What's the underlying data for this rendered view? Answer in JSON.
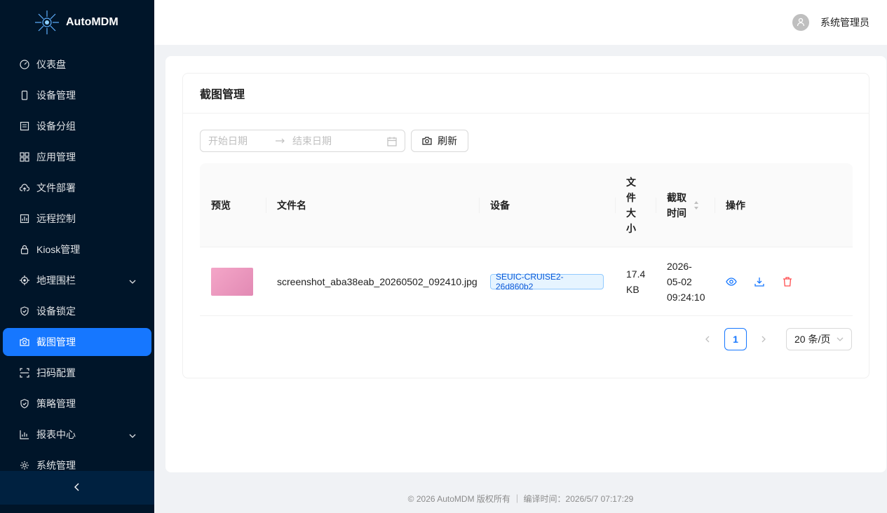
{
  "app": {
    "name": "AutoMDM"
  },
  "sidebar": {
    "items": [
      {
        "label": "仪表盘",
        "icon": "dashboard-icon"
      },
      {
        "label": "设备管理",
        "icon": "mobile-icon"
      },
      {
        "label": "设备分组",
        "icon": "group-icon"
      },
      {
        "label": "应用管理",
        "icon": "appstore-icon"
      },
      {
        "label": "文件部署",
        "icon": "cloud-upload-icon"
      },
      {
        "label": "远程控制",
        "icon": "remote-control-icon"
      },
      {
        "label": "Kiosk管理",
        "icon": "lock-icon"
      },
      {
        "label": "地理围栏",
        "icon": "aim-icon",
        "has_submenu": true
      },
      {
        "label": "设备锁定",
        "icon": "safety-icon"
      },
      {
        "label": "截图管理",
        "icon": "camera-icon",
        "active": true
      },
      {
        "label": "扫码配置",
        "icon": "scan-icon"
      },
      {
        "label": "策略管理",
        "icon": "shield-icon"
      },
      {
        "label": "报表中心",
        "icon": "bar-chart-icon",
        "has_submenu": true
      },
      {
        "label": "系统管理",
        "icon": "setting-icon"
      }
    ]
  },
  "header": {
    "user_name": "系统管理员"
  },
  "page": {
    "title": "截图管理",
    "date_range": {
      "start_placeholder": "开始日期",
      "end_placeholder": "结束日期"
    },
    "refresh_label": "刷新"
  },
  "table": {
    "columns": {
      "preview": "预览",
      "filename": "文件名",
      "device": "设备",
      "size_lines": [
        "文",
        "件",
        "大",
        "小"
      ],
      "time_lines": [
        "截取",
        "时间"
      ],
      "actions": "操作"
    },
    "rows": [
      {
        "filename": "screenshot_aba38eab_20260502_092410.jpg",
        "device": "SEUIC-CRUISE2-26d860b2",
        "size_lines": [
          "17.4",
          "KB"
        ],
        "time_lines": [
          "2026-",
          "05-02",
          "09:24:10"
        ]
      }
    ]
  },
  "pagination": {
    "current": "1",
    "page_size": "20 条/页"
  },
  "footer": {
    "text": "© 2026 AutoMDM 版权所有 ｜ 编译时间：2026/5/7 07:17:29"
  },
  "colors": {
    "primary": "#1677ff",
    "sidebar_bg": "#001529",
    "danger": "#ff4d4f"
  }
}
